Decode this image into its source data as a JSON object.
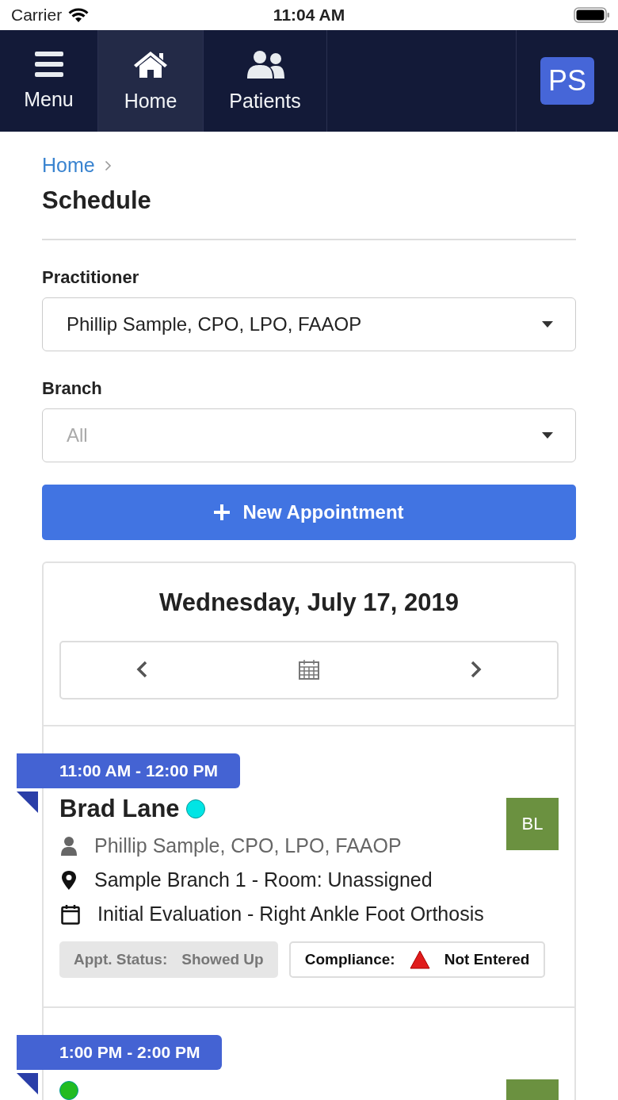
{
  "status_bar": {
    "carrier": "Carrier",
    "time": "11:04 AM"
  },
  "nav": {
    "tabs": [
      {
        "label": "Menu",
        "kind": "menu",
        "selected": false
      },
      {
        "label": "Home",
        "kind": "home",
        "selected": true
      },
      {
        "label": "Patients",
        "kind": "users",
        "selected": false
      }
    ],
    "user_initials": "PS"
  },
  "breadcrumb": [
    "Home"
  ],
  "title": "Schedule",
  "practitioner": {
    "label": "Practitioner",
    "value": "Phillip Sample, CPO, LPO, FAAOP"
  },
  "branch": {
    "label": "Branch",
    "placeholder": "All"
  },
  "new_button": "New Appointment",
  "date": "Wednesday, July 17, 2019",
  "appointments": [
    {
      "time": "11:00 AM - 12:00 PM",
      "patient": "Brad Lane",
      "color": "#00e5e5",
      "initials": "BL",
      "practitioner": "Phillip Sample, CPO, LPO, FAAOP",
      "location": "Sample Branch 1 - Room: Unassigned",
      "type": "Initial Evaluation - Right Ankle Foot Orthosis",
      "status_label": "Appt. Status:",
      "status": "Showed Up",
      "compliance_label": "Compliance:",
      "compliance": "Not Entered"
    },
    {
      "time": "1:00 PM - 2:00 PM",
      "color": "#22bb22"
    }
  ]
}
